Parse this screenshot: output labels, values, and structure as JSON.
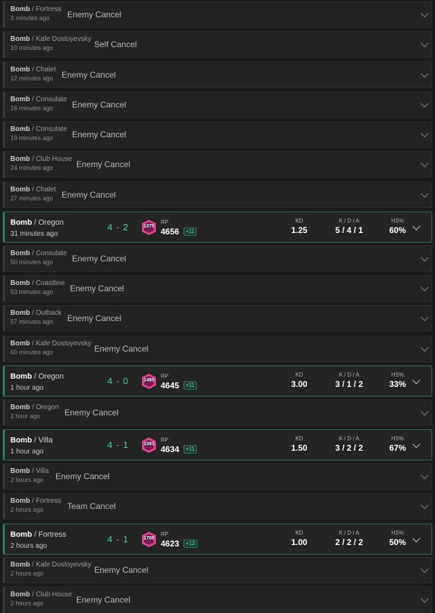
{
  "matches": [
    {
      "type": "cancel",
      "mode": "Bomb",
      "map": "Fortress",
      "time": "3 minutes ago",
      "status": "Enemy Cancel"
    },
    {
      "type": "cancel",
      "mode": "Bomb",
      "map": "Kafe Dostoyevsky",
      "time": "10 minutes ago",
      "status": "Self Cancel"
    },
    {
      "type": "cancel",
      "mode": "Bomb",
      "map": "Chalet",
      "time": "12 minutes ago",
      "status": "Enemy Cancel"
    },
    {
      "type": "cancel",
      "mode": "Bomb",
      "map": "Consulate",
      "time": "16 minutes ago",
      "status": "Enemy Cancel"
    },
    {
      "type": "cancel",
      "mode": "Bomb",
      "map": "Consulate",
      "time": "19 minutes ago",
      "status": "Enemy Cancel"
    },
    {
      "type": "cancel",
      "mode": "Bomb",
      "map": "Club House",
      "time": "24 minutes ago",
      "status": "Enemy Cancel"
    },
    {
      "type": "cancel",
      "mode": "Bomb",
      "map": "Chalet",
      "time": "27 minutes ago",
      "status": "Enemy Cancel"
    },
    {
      "type": "win",
      "mode": "Bomb",
      "map": "Oregon",
      "time": "31 minutes ago",
      "score": "4 - 2",
      "rank_badge": "1375",
      "rp_label": "RP",
      "rp": "4656",
      "rp_delta": "+11",
      "kd_label": "KD",
      "kd": "1.25",
      "kda_label": "K / D / A",
      "kda": "5 / 4 / 1",
      "hs_label": "HS%",
      "hs": "60%"
    },
    {
      "type": "cancel",
      "mode": "Bomb",
      "map": "Consulate",
      "time": "50 minutes ago",
      "status": "Enemy Cancel"
    },
    {
      "type": "cancel",
      "mode": "Bomb",
      "map": "Coastline",
      "time": "53 minutes ago",
      "status": "Enemy Cancel"
    },
    {
      "type": "cancel",
      "mode": "Bomb",
      "map": "Outback",
      "time": "57 minutes ago",
      "status": "Enemy Cancel"
    },
    {
      "type": "cancel",
      "mode": "Bomb",
      "map": "Kafe Dostoyevsky",
      "time": "60 minutes ago",
      "status": "Enemy Cancel"
    },
    {
      "type": "win",
      "mode": "Bomb",
      "map": "Oregon",
      "time": "1 hour ago",
      "score": "4 - 0",
      "rank_badge": "1485",
      "rp_label": "RP",
      "rp": "4645",
      "rp_delta": "+11",
      "kd_label": "KD",
      "kd": "3.00",
      "kda_label": "K / D / A",
      "kda": "3 / 1 / 2",
      "hs_label": "HS%",
      "hs": "33%"
    },
    {
      "type": "cancel",
      "mode": "Bomb",
      "map": "Oregon",
      "time": "1 hour ago",
      "status": "Enemy Cancel"
    },
    {
      "type": "win",
      "mode": "Bomb",
      "map": "Villa",
      "time": "1 hour ago",
      "score": "4 - 1",
      "rank_badge": "1593",
      "rp_label": "RP",
      "rp": "4634",
      "rp_delta": "+11",
      "kd_label": "KD",
      "kd": "1.50",
      "kda_label": "K / D / A",
      "kda": "3 / 2 / 2",
      "hs_label": "HS%",
      "hs": "67%"
    },
    {
      "type": "cancel",
      "mode": "Bomb",
      "map": "Villa",
      "time": "2 hours ago",
      "status": "Enemy Cancel"
    },
    {
      "type": "cancel",
      "mode": "Bomb",
      "map": "Fortress",
      "time": "2 hours ago",
      "status": "Team Cancel"
    },
    {
      "type": "win",
      "mode": "Bomb",
      "map": "Fortress",
      "time": "2 hours ago",
      "score": "4 - 1",
      "rank_badge": "1708",
      "rp_label": "RP",
      "rp": "4623",
      "rp_delta": "+12",
      "kd_label": "KD",
      "kd": "1.00",
      "kda_label": "K / D / A",
      "kda": "2 / 2 / 2",
      "hs_label": "HS%",
      "hs": "50%"
    },
    {
      "type": "cancel",
      "mode": "Bomb",
      "map": "Kafe Dostoyevsky",
      "time": "2 hours ago",
      "status": "Enemy Cancel"
    },
    {
      "type": "cancel",
      "mode": "Bomb",
      "map": "Club House",
      "time": "2 hours ago",
      "status": "Enemy Cancel"
    }
  ],
  "map_separator": " / ",
  "colors": {
    "win_border": "#2f6b4f",
    "score": "#3fd49a",
    "rank_badge": "#e6439b",
    "background": "#1b1b1b"
  },
  "icons": {
    "rank": "rank-emblem-icon",
    "expand": "chevron-down-icon"
  }
}
